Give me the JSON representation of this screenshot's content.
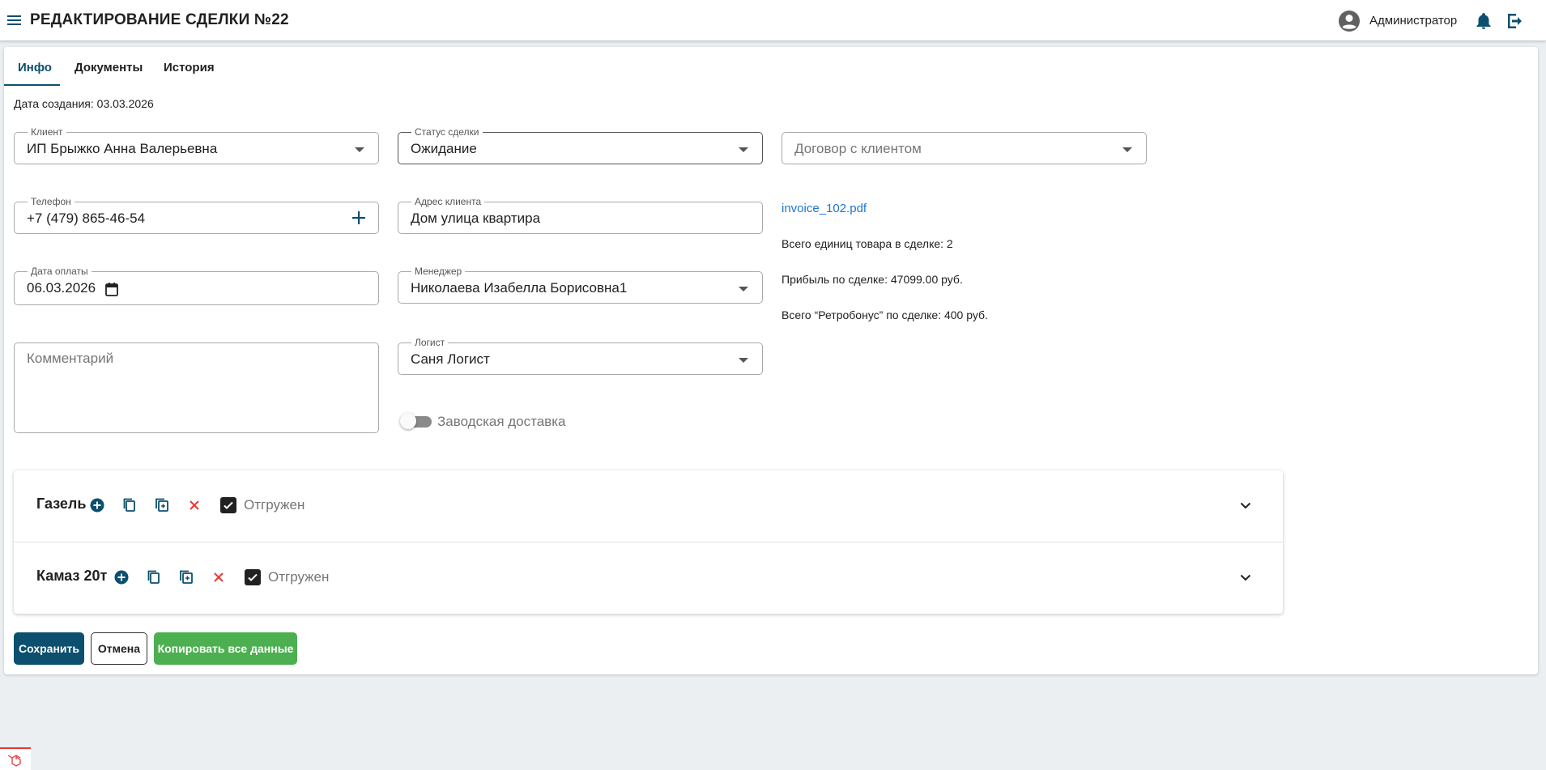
{
  "header": {
    "title": "РЕДАКТИРОВАНИЕ СДЕЛКИ №22",
    "user_name": "Администратор",
    "icons": [
      "menu-icon",
      "account-circle-icon",
      "bell-icon",
      "logout-icon"
    ]
  },
  "tabs": [
    {
      "label": "Инфо",
      "active": true
    },
    {
      "label": "Документы",
      "active": false
    },
    {
      "label": "История",
      "active": false
    }
  ],
  "created_text": "Дата создания: 03.03.2026",
  "form": {
    "client": {
      "label": "Клиент",
      "value": "ИП Брыжко Анна Валерьевна"
    },
    "status": {
      "label": "Статус сделки",
      "value": "Ожидание"
    },
    "contract": {
      "placeholder": "Договор с клиентом"
    },
    "phone": {
      "label": "Телефон",
      "value": "+7 (479) 865-46-54"
    },
    "address": {
      "label": "Адрес клиента",
      "value": "Дом улица квартира"
    },
    "payment_date": {
      "label": "Дата оплаты",
      "value": "06.03.2026"
    },
    "manager": {
      "label": "Менеджер",
      "value": "Николаева Изабелла Борисовна1"
    },
    "comment": {
      "placeholder": "Комментарий"
    },
    "logist": {
      "label": "Логист",
      "value": "Саня Логист"
    },
    "factory_delivery": {
      "label": "Заводская доставка",
      "checked": false
    }
  },
  "info": {
    "file_link": "invoice_102.pdf",
    "units_total": "Всего единиц товара в сделке: 2",
    "profit": "Прибыль по сделке: 47099.00 руб.",
    "retrobonus": "Всего “Ретробонус” по сделке: 400 руб."
  },
  "vehicles": [
    {
      "name": "Газель",
      "shipped_label": "Отгружен",
      "shipped": true
    },
    {
      "name": "Камаз 20т",
      "shipped_label": "Отгружен",
      "shipped": true
    }
  ],
  "actions": {
    "save": "Сохранить",
    "cancel": "Отмена",
    "copy_all": "Копировать все данные"
  },
  "colors": {
    "primary": "#0d4f6e",
    "success": "#4caf50",
    "danger": "#e53935",
    "link": "#1976d2"
  }
}
